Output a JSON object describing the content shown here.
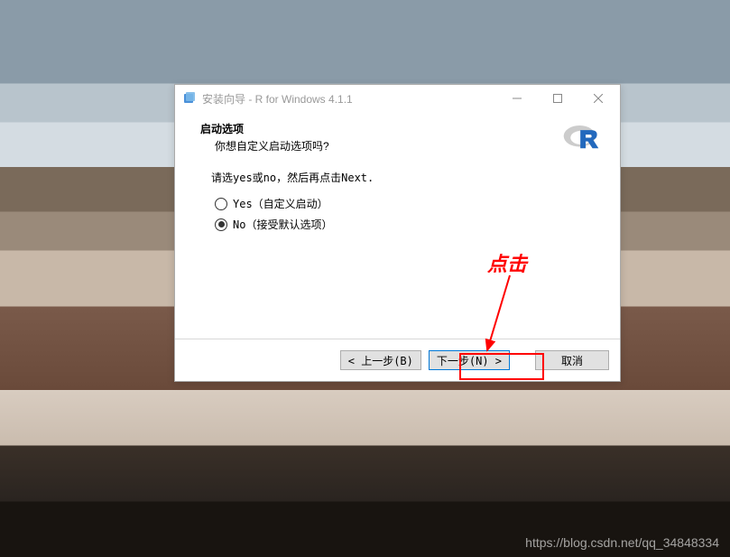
{
  "titlebar": {
    "text": "安装向导 - R for Windows 4.1.1"
  },
  "heading": {
    "title": "启动选项",
    "subtitle": "你想自定义启动选项吗?"
  },
  "instruction": "请选yes或no，然后再点击Next.",
  "options": {
    "yes": "Yes（自定义启动）",
    "no": "No（接受默认选项）"
  },
  "buttons": {
    "back": "< 上一步(B)",
    "next": "下一步(N) >",
    "cancel": "取消"
  },
  "annotation": "点击",
  "watermark": "https://blog.csdn.net/qq_34848334"
}
